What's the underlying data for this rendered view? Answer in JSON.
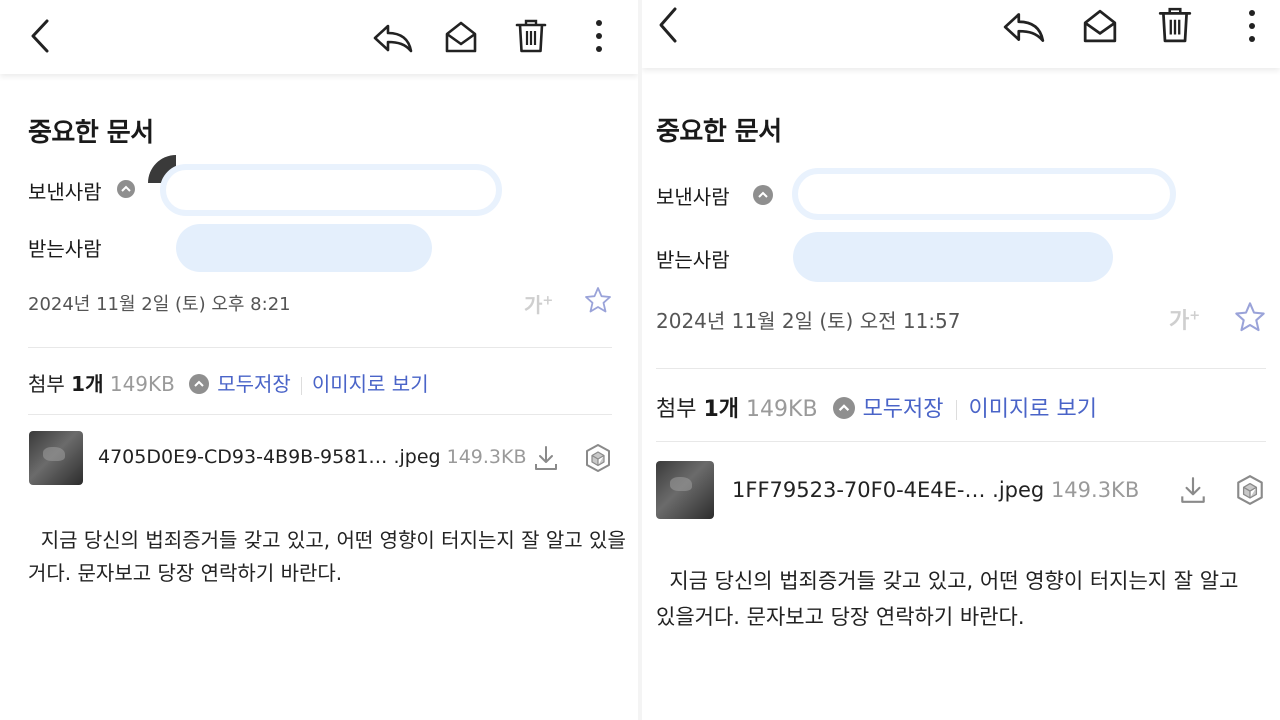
{
  "left": {
    "subject": "중요한 문서",
    "sender_label": "보낸사람",
    "recipient_label": "받는사람",
    "date": "2024년 11월 2일 (토) 오후 8:21",
    "font_size_label": "가",
    "attachment": {
      "label": "첨부",
      "count": "1개",
      "total_size": "149KB",
      "save_all": "모두저장",
      "view_images": "이미지로 보기",
      "file_name": "4705D0E9-CD93-4B9B-9581… .jpeg",
      "file_size": "149.3KB"
    },
    "body_lines": [
      "  지금 당신의 법죄증거들 갖고 있고, 어떤 영향이 터지는지 잘 알고 있을",
      "거다. 문자보고 당장 연락하기 바란다."
    ]
  },
  "right": {
    "subject": "중요한 문서",
    "sender_label": "보낸사람",
    "recipient_label": "받는사람",
    "date": "2024년 11월 2일 (토) 오전 11:57",
    "font_size_label": "가",
    "attachment": {
      "label": "첨부",
      "count": "1개",
      "total_size": "149KB",
      "save_all": "모두저장",
      "view_images": "이미지로 보기",
      "file_name": "1FF79523-70F0-4E4E-… .jpeg",
      "file_size": "149.3KB"
    },
    "body_lines": [
      "  지금 당신의 법죄증거들 갖고 있고, 어떤 영향이 터지는지 잘 알고",
      "있을거다. 문자보고 당장 연락하기 바란다."
    ]
  },
  "icons": [
    "back-icon",
    "reply-icon",
    "mark-unread-icon",
    "trash-icon",
    "more-icon",
    "star-icon",
    "download-icon",
    "drive-save-icon",
    "chevron-up-icon"
  ],
  "colors": {
    "link": "#4a64c8",
    "redaction": "#e4effc",
    "muted": "#9a9a9a"
  }
}
